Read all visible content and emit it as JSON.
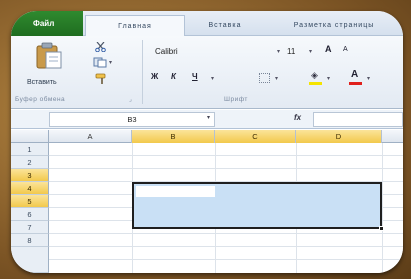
{
  "ribbon": {
    "tabs": {
      "file": "Файл",
      "home": "Главная",
      "insert": "Вставка",
      "page_layout": "Разметка страницы"
    },
    "clipboard": {
      "paste_label": "Вставить",
      "group_label": "Буфер обмена"
    },
    "font": {
      "font_name": "Calibri",
      "font_size": "11",
      "grow_label": "A",
      "shrink_label": "A",
      "bold_label": "Ж",
      "italic_label": "К",
      "underline_label": "Ч",
      "font_color_label": "A",
      "group_label": "Шрифт",
      "fill_color": "#f5e400",
      "font_color": "#e0201c"
    }
  },
  "formula_bar": {
    "name_box": "B3",
    "fx_label": "fx",
    "formula": ""
  },
  "sheet": {
    "columns": [
      "A",
      "B",
      "C",
      "D"
    ],
    "selected_columns": [
      "B",
      "C",
      "D"
    ],
    "rows": [
      "1",
      "2",
      "3",
      "4",
      "5",
      "6",
      "7",
      "8"
    ],
    "selected_rows": [
      "3",
      "4",
      "5"
    ],
    "selection_range": "B3:D5",
    "active_cell": "B3",
    "selection_color": "#c9e0f5"
  },
  "icons": {
    "paste": "clipboard-paste-icon",
    "cut": "scissors-icon",
    "copy": "copy-icon",
    "format_painter": "brush-icon",
    "borders": "borders-icon",
    "fill": "bucket-icon",
    "font_color": "font-color-icon",
    "fx": "function-icon"
  }
}
